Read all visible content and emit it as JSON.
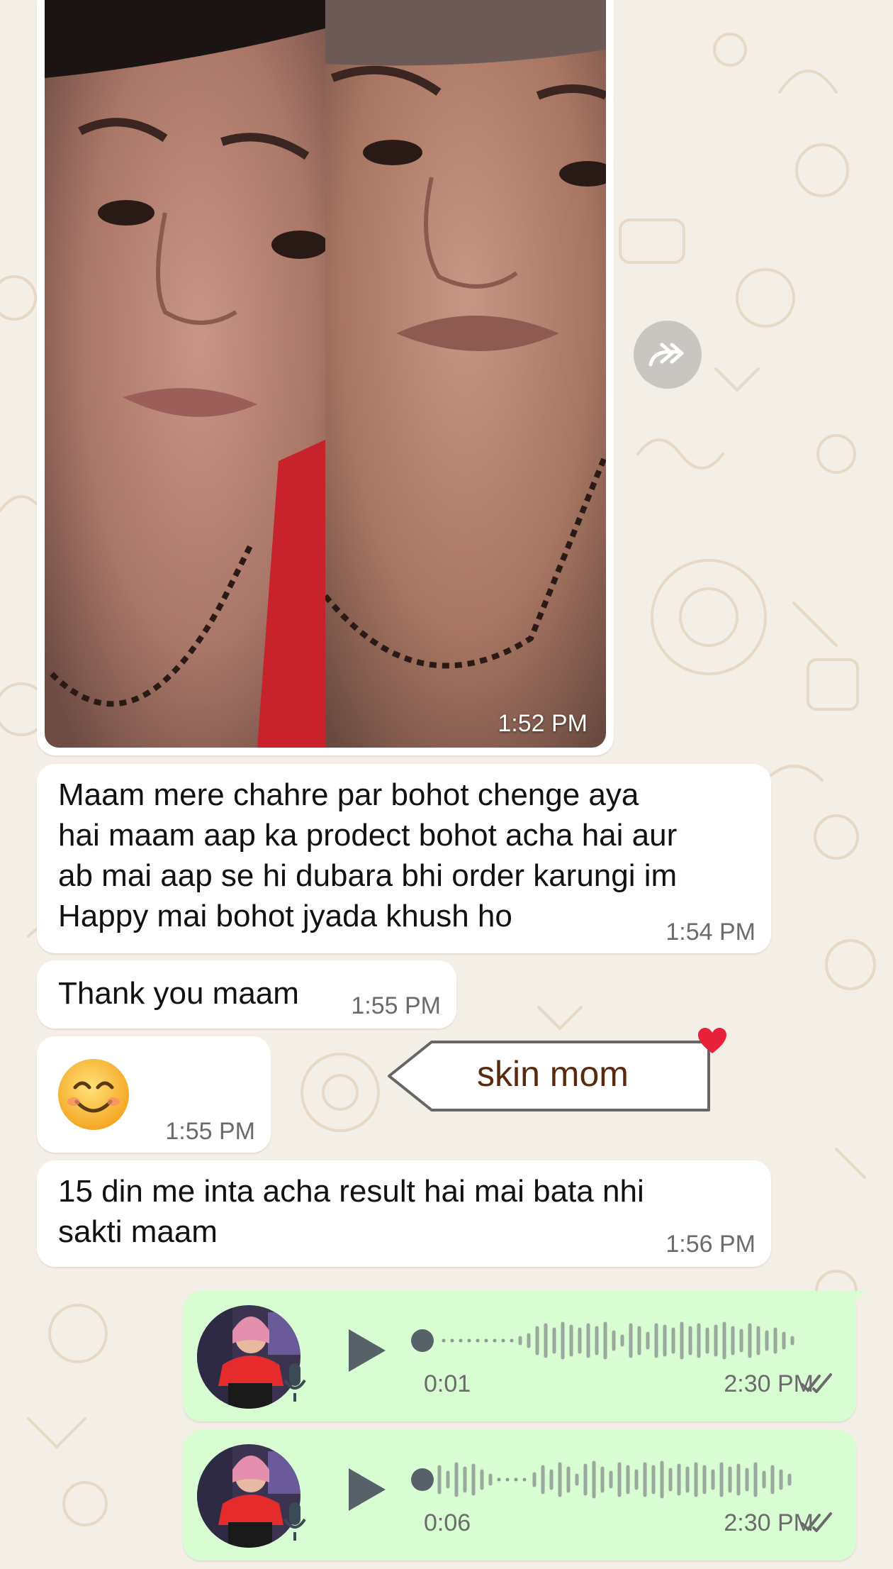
{
  "photo_message": {
    "time": "1:52 PM"
  },
  "messages": [
    {
      "text_lines": [
        "Maam mere chahre par bohot chenge aya",
        "hai maam aap ka prodect bohot acha hai aur",
        "ab mai aap se hi dubara bhi order karungi im",
        "Happy mai bohot jyada khush ho"
      ],
      "time": "1:54 PM"
    },
    {
      "text": "Thank you maam",
      "time": "1:55 PM"
    },
    {
      "emoji": "😊",
      "time": "1:55 PM"
    },
    {
      "text_lines": [
        "15 din me inta acha result hai mai bata nhi",
        "sakti maam"
      ],
      "time": "1:56 PM"
    }
  ],
  "tag": {
    "label": "skin mom"
  },
  "voice_notes": [
    {
      "duration": "0:01",
      "time": "2:30 PM"
    },
    {
      "duration": "0:06",
      "time": "2:30 PM"
    }
  ],
  "colors": {
    "incoming_bg": "#ffffff",
    "outgoing_bg": "#d9fdd3",
    "wallpaper": "#f4efe6",
    "read_ticks": "#6b6b6b",
    "heart": "#e8213a"
  },
  "icons": [
    "forward-icon",
    "play-icon",
    "mic-icon",
    "double-check-icon",
    "heart-icon",
    "smiling-face-emoji"
  ]
}
